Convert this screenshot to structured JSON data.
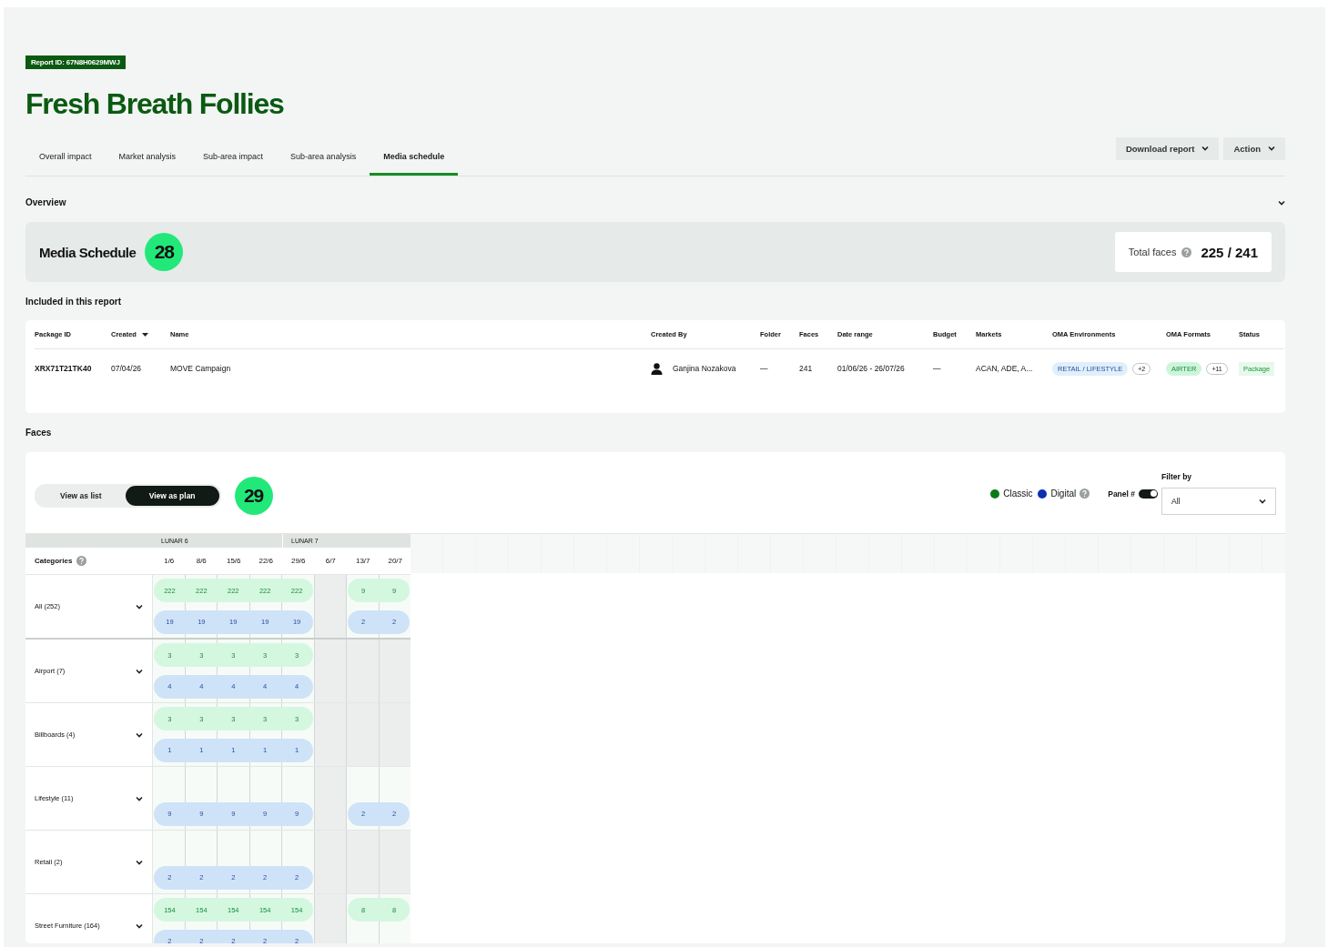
{
  "report_id": "Report ID: 67N8H0629MWJ",
  "title": "Fresh Breath Follies",
  "tabs": [
    {
      "label": "Overall impact",
      "selected": false
    },
    {
      "label": "Market analysis",
      "selected": false
    },
    {
      "label": "Sub-area impact",
      "selected": false
    },
    {
      "label": "Sub-area analysis",
      "selected": false
    },
    {
      "label": "Media schedule",
      "selected": true
    }
  ],
  "header_buttons": [
    "Download report",
    "Action"
  ],
  "overview": {
    "title": "Overview",
    "schedule_title": "Media Schedule",
    "schedule_count": "28",
    "total_label": "Total faces",
    "total_value": "225 / 241"
  },
  "included": {
    "title": "Included in this report",
    "columns": [
      {
        "label": "Package ID",
        "sorted": false
      },
      {
        "label": "Created",
        "sorted": true
      },
      {
        "label": "Name",
        "sorted": false
      },
      {
        "label": "Created By",
        "sorted": false
      },
      {
        "label": "Folder",
        "sorted": false
      },
      {
        "label": "Faces",
        "sorted": false
      },
      {
        "label": "Date range",
        "sorted": false
      },
      {
        "label": "Budget",
        "sorted": false
      },
      {
        "label": "Markets",
        "sorted": false
      },
      {
        "label": "OMA Environments",
        "sorted": false
      },
      {
        "label": "OMA Formats",
        "sorted": false
      },
      {
        "label": "Status",
        "sorted": false
      }
    ],
    "rows": [
      {
        "package_id": "XRX71T21TK40",
        "created": "07/04/26",
        "name": "MOVE Campaign",
        "created_by": "Ganjina Nozakova",
        "folder": "—",
        "faces": "241",
        "date_range": "01/06/26 - 26/07/26",
        "budget": "—",
        "markets": "ACAN, ADE, A...",
        "environment": "RETAIL / LIFESTYLE",
        "environment_more": "+2",
        "format": "AIRTER",
        "format_more": "+11",
        "status": "Package"
      }
    ]
  },
  "faces": {
    "title": "Faces",
    "view_options": [
      {
        "label": "View as list",
        "selected": false
      },
      {
        "label": "View as plan",
        "selected": true
      }
    ],
    "count": "29",
    "legend": [
      {
        "label": "Classic",
        "color": "#0d7a1a"
      },
      {
        "label": "Digital",
        "color": "#0d2fb0"
      }
    ],
    "panel_label": "Panel #",
    "panel_on": true,
    "filter": {
      "label": "Filter by",
      "value": "All"
    },
    "lunar": [
      {
        "label": "LUNAR 6",
        "weeks": [
          "1/6",
          "8/6",
          "15/6",
          "22/6"
        ]
      },
      {
        "label": "LUNAR 7",
        "weeks": [
          "29/6",
          "6/7",
          "13/7",
          "20/7"
        ]
      }
    ],
    "categories_label": "Categories",
    "categories": [
      {
        "label": "All (252)",
        "weeks": [
          {
            "scheduled": true,
            "classic": "222",
            "digital": "19"
          },
          {
            "scheduled": true,
            "classic": "222",
            "digital": "19"
          },
          {
            "scheduled": true,
            "classic": "222",
            "digital": "19"
          },
          {
            "scheduled": true,
            "classic": "222",
            "digital": "19"
          },
          {
            "scheduled": true,
            "classic": "222",
            "digital": "19"
          },
          {
            "scheduled": false
          },
          {
            "scheduled": true,
            "classic": "9",
            "digital": "2"
          },
          {
            "scheduled": true,
            "classic": "9",
            "digital": "2"
          }
        ]
      },
      {
        "label": "Airport (7)",
        "weeks": [
          {
            "scheduled": true,
            "classic": "3",
            "digital": "4"
          },
          {
            "scheduled": true,
            "classic": "3",
            "digital": "4"
          },
          {
            "scheduled": true,
            "classic": "3",
            "digital": "4"
          },
          {
            "scheduled": true,
            "classic": "3",
            "digital": "4"
          },
          {
            "scheduled": true,
            "classic": "3",
            "digital": "4"
          },
          {
            "scheduled": false
          },
          {
            "scheduled": false
          },
          {
            "scheduled": false
          }
        ]
      },
      {
        "label": "Billboards (4)",
        "weeks": [
          {
            "scheduled": true,
            "classic": "3",
            "digital": "1"
          },
          {
            "scheduled": true,
            "classic": "3",
            "digital": "1"
          },
          {
            "scheduled": true,
            "classic": "3",
            "digital": "1"
          },
          {
            "scheduled": true,
            "classic": "3",
            "digital": "1"
          },
          {
            "scheduled": true,
            "classic": "3",
            "digital": "1"
          },
          {
            "scheduled": false
          },
          {
            "scheduled": false
          },
          {
            "scheduled": false
          }
        ]
      },
      {
        "label": "Lifestyle (11)",
        "weeks": [
          {
            "scheduled": true,
            "digital": "9"
          },
          {
            "scheduled": true,
            "digital": "9"
          },
          {
            "scheduled": true,
            "digital": "9"
          },
          {
            "scheduled": true,
            "digital": "9"
          },
          {
            "scheduled": true,
            "digital": "9"
          },
          {
            "scheduled": false
          },
          {
            "scheduled": true,
            "digital": "2"
          },
          {
            "scheduled": true,
            "digital": "2"
          }
        ]
      },
      {
        "label": "Retail (2)",
        "weeks": [
          {
            "scheduled": true,
            "digital": "2"
          },
          {
            "scheduled": true,
            "digital": "2"
          },
          {
            "scheduled": true,
            "digital": "2"
          },
          {
            "scheduled": true,
            "digital": "2"
          },
          {
            "scheduled": true,
            "digital": "2"
          },
          {
            "scheduled": false
          },
          {
            "scheduled": false
          },
          {
            "scheduled": false
          }
        ]
      },
      {
        "label": "Street Furniture (164)",
        "weeks": [
          {
            "scheduled": true,
            "classic": "154",
            "digital": "2"
          },
          {
            "scheduled": true,
            "classic": "154",
            "digital": "2"
          },
          {
            "scheduled": true,
            "classic": "154",
            "digital": "2"
          },
          {
            "scheduled": true,
            "classic": "154",
            "digital": "2"
          },
          {
            "scheduled": true,
            "classic": "154",
            "digital": "2"
          },
          {
            "scheduled": false
          },
          {
            "scheduled": true,
            "classic": "8"
          },
          {
            "scheduled": true,
            "classic": "8"
          }
        ]
      }
    ]
  }
}
